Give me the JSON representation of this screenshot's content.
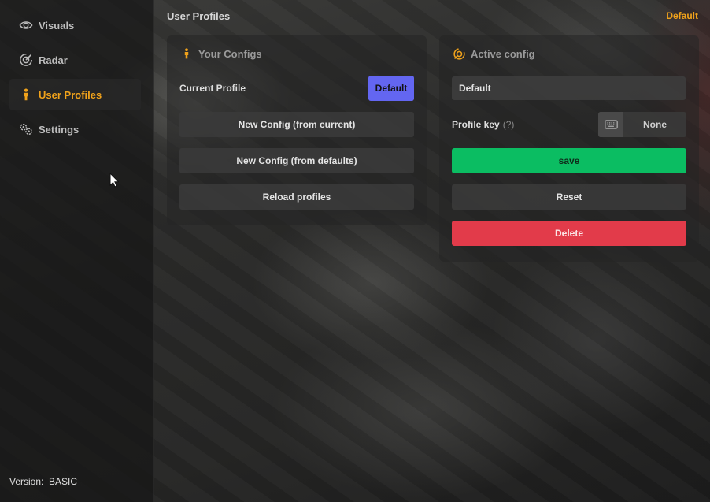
{
  "sidebar": {
    "items": [
      {
        "label": "Visuals",
        "icon": "eye-icon"
      },
      {
        "label": "Radar",
        "icon": "radar-icon"
      },
      {
        "label": "User Profiles",
        "icon": "person-icon"
      },
      {
        "label": "Settings",
        "icon": "gears-icon"
      }
    ],
    "active_index": 2,
    "version_label": "Version:",
    "version_value": "BASIC"
  },
  "header": {
    "title": "User Profiles",
    "current_profile": "Default"
  },
  "your_configs": {
    "title": "Your Configs",
    "current_profile_label": "Current Profile",
    "current_profile_value": "Default",
    "new_from_current": "New Config (from current)",
    "new_from_defaults": "New Config (from defaults)",
    "reload": "Reload profiles"
  },
  "active_config": {
    "title": "Active config",
    "name_value": "Default",
    "profile_key_label": "Profile key",
    "profile_key_help": "(?)",
    "profile_key_value": "None",
    "save": "save",
    "reset": "Reset",
    "delete": "Delete"
  },
  "colors": {
    "accent": "#f0a21b",
    "primary": "#6366f1",
    "save": "#0bbd62",
    "delete": "#e23b4a"
  }
}
